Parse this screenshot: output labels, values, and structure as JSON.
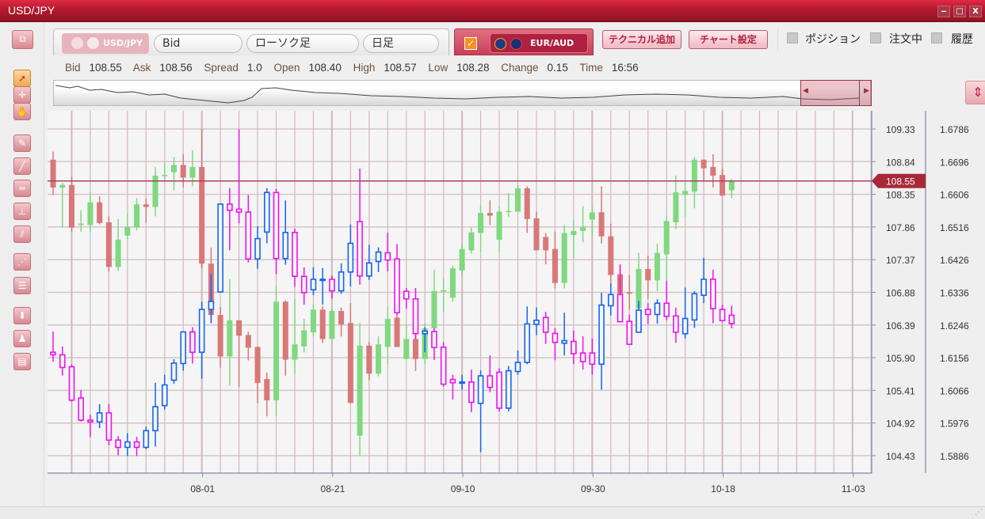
{
  "window": {
    "title": "USD/JPY",
    "controls": [
      "‒",
      "□",
      "X"
    ]
  },
  "toolbar": {
    "primary_symbol": "USD/JPY",
    "price_type": "Bid",
    "chart_type": "ローソク足",
    "timeframe": "日足",
    "compare_checked": true,
    "compare_check_glyph": "✓",
    "secondary_symbol": "EUR/AUD",
    "add_technical": "テクニカル追加",
    "chart_settings": "チャート設定",
    "toggles": [
      {
        "label": "ポジション",
        "checked": false
      },
      {
        "label": "注文中",
        "checked": false
      },
      {
        "label": "履歴",
        "checked": false
      }
    ]
  },
  "info_bar": [
    {
      "key": "Bid",
      "value": "108.55"
    },
    {
      "key": "Ask",
      "value": "108.56"
    },
    {
      "key": "Spread",
      "value": "1.0"
    },
    {
      "key": "Open",
      "value": "108.40"
    },
    {
      "key": "High",
      "value": "108.57"
    },
    {
      "key": "Low",
      "value": "108.28"
    },
    {
      "key": "Change",
      "value": "0.15"
    },
    {
      "key": "Time",
      "value": "16:56"
    }
  ],
  "left_tools": [
    "window-layout-icon",
    "cursor-icon",
    "crosshair-cursor-icon",
    "hand-icon",
    "pencil-icon",
    "trendline-icon",
    "horizontal-line-icon",
    "vertical-line-icon",
    "channel-icon",
    "fan-icon",
    "fibonacci-icon",
    "download-icon",
    "alert-icon",
    "list-icon"
  ],
  "colors": {
    "up_primary": "#80d880",
    "down_primary": "#d87878",
    "up_secondary": "#1464f0",
    "down_secondary": "#f010f0",
    "price_line": "#b04060",
    "accent": "#c02040"
  },
  "chart_data": {
    "type": "candlestick",
    "current_price_label": "108.55",
    "current_price": 108.55,
    "x_tick_labels": [
      "08-01",
      "08-21",
      "09-10",
      "09-30",
      "10-18",
      "11-03"
    ],
    "x_tick_candle_index": [
      16,
      30,
      44,
      58,
      72,
      86
    ],
    "left_axis": {
      "ylim": [
        104.43,
        109.33
      ],
      "ticks": [
        "109.33",
        "108.84",
        "108.35",
        "107.86",
        "107.37",
        "106.88",
        "106.39",
        "105.90",
        "105.41",
        "104.92",
        "104.43"
      ]
    },
    "right_axis": {
      "ylim": [
        1.5886,
        1.6786
      ],
      "ticks": [
        "1.6786",
        "1.6696",
        "1.6606",
        "1.6516",
        "1.6426",
        "1.6336",
        "1.6246",
        "1.6156",
        "1.6066",
        "1.5976",
        "1.5886"
      ]
    },
    "grid": true,
    "series": [
      {
        "name": "USD/JPY",
        "axis": "left",
        "ohlc": [
          [
            108.87,
            108.99,
            108.34,
            108.45
          ],
          [
            108.45,
            108.52,
            107.85,
            108.49
          ],
          [
            108.49,
            108.61,
            107.79,
            107.85
          ],
          [
            107.89,
            108.11,
            107.79,
            107.91
          ],
          [
            107.89,
            108.38,
            107.79,
            108.23
          ],
          [
            108.23,
            108.32,
            107.9,
            107.92
          ],
          [
            107.93,
            108.02,
            107.19,
            107.26
          ],
          [
            107.26,
            107.98,
            107.2,
            107.67
          ],
          [
            107.73,
            108.07,
            107.68,
            107.86
          ],
          [
            107.85,
            108.29,
            107.81,
            108.2
          ],
          [
            108.2,
            108.29,
            107.92,
            108.16
          ],
          [
            108.16,
            108.76,
            108.02,
            108.63
          ],
          [
            108.63,
            108.82,
            108.56,
            108.64
          ],
          [
            108.68,
            108.91,
            108.41,
            108.79
          ],
          [
            108.79,
            108.95,
            108.45,
            108.6
          ],
          [
            108.6,
            109.01,
            108.47,
            108.76
          ],
          [
            108.76,
            109.33,
            107.24,
            107.31
          ],
          [
            107.31,
            107.55,
            106.42,
            106.54
          ],
          [
            106.54,
            106.66,
            105.75,
            105.92
          ],
          [
            105.92,
            107.08,
            105.48,
            106.46
          ],
          [
            106.46,
            106.46,
            105.46,
            106.23
          ],
          [
            106.24,
            106.29,
            105.86,
            106.05
          ],
          [
            106.06,
            106.07,
            105.22,
            105.52
          ],
          [
            105.58,
            105.68,
            105.02,
            105.26
          ],
          [
            105.26,
            106.98,
            105.02,
            106.74
          ],
          [
            106.74,
            106.76,
            105.63,
            105.87
          ],
          [
            105.87,
            106.78,
            105.66,
            106.1
          ],
          [
            106.07,
            106.48,
            105.98,
            106.31
          ],
          [
            106.28,
            106.7,
            106.22,
            106.62
          ],
          [
            106.62,
            106.67,
            106.12,
            106.18
          ],
          [
            106.18,
            106.66,
            106.18,
            106.6
          ],
          [
            106.6,
            106.65,
            106.22,
            106.4
          ],
          [
            106.42,
            106.72,
            105.22,
            105.22
          ],
          [
            104.73,
            106.42,
            104.43,
            106.08
          ],
          [
            106.08,
            106.14,
            105.56,
            105.66
          ],
          [
            105.66,
            106.22,
            105.62,
            106.1
          ],
          [
            106.06,
            106.66,
            105.8,
            106.48
          ],
          [
            106.5,
            106.55,
            106.06,
            106.06
          ],
          [
            105.88,
            106.4,
            105.88,
            106.18
          ],
          [
            106.18,
            106.37,
            105.7,
            105.88
          ],
          [
            105.88,
            106.42,
            105.8,
            106.34
          ],
          [
            106.34,
            107.22,
            106.24,
            106.9
          ],
          [
            106.9,
            107.1,
            106.58,
            106.91
          ],
          [
            106.8,
            107.28,
            106.74,
            107.24
          ],
          [
            107.21,
            107.59,
            107.14,
            107.53
          ],
          [
            107.51,
            107.85,
            107.46,
            107.78
          ],
          [
            107.77,
            108.19,
            107.49,
            108.07
          ],
          [
            108.07,
            108.26,
            107.89,
            108.03
          ],
          [
            107.67,
            108.17,
            107.49,
            108.09
          ],
          [
            108.09,
            108.37,
            108.01,
            108.1
          ],
          [
            108.09,
            108.49,
            108.09,
            108.44
          ],
          [
            108.44,
            108.47,
            107.77,
            107.98
          ],
          [
            107.99,
            108.09,
            107.51,
            107.51
          ],
          [
            107.71,
            107.77,
            107.3,
            107.51
          ],
          [
            107.53,
            107.79,
            106.94,
            107.02
          ],
          [
            107.02,
            107.89,
            106.94,
            107.77
          ],
          [
            107.74,
            107.97,
            107.39,
            107.8
          ],
          [
            107.8,
            108.17,
            107.63,
            107.86
          ],
          [
            107.97,
            108.17,
            107.73,
            108.08
          ],
          [
            108.08,
            108.47,
            107.61,
            107.72
          ],
          [
            107.72,
            107.91,
            107.02,
            107.14
          ],
          [
            107.15,
            107.3,
            106.62,
            106.86
          ],
          [
            106.88,
            107.14,
            106.62,
            106.86
          ],
          [
            106.64,
            107.47,
            106.64,
            107.23
          ],
          [
            107.23,
            107.43,
            106.78,
            107.06
          ],
          [
            107.06,
            107.61,
            106.9,
            107.47
          ],
          [
            107.45,
            108.03,
            107.06,
            107.95
          ],
          [
            107.93,
            108.63,
            107.83,
            108.38
          ],
          [
            108.34,
            108.53,
            108.01,
            108.4
          ],
          [
            108.39,
            108.91,
            108.14,
            108.87
          ],
          [
            108.87,
            108.87,
            108.56,
            108.74
          ],
          [
            108.76,
            108.95,
            108.45,
            108.63
          ],
          [
            108.64,
            108.73,
            108.33,
            108.33
          ],
          [
            108.41,
            108.58,
            108.29,
            108.55
          ]
        ]
      },
      {
        "name": "EUR/AUD",
        "axis": "right",
        "ohlc": [
          [
            1.6171,
            1.6228,
            1.6145,
            1.6164
          ],
          [
            1.6164,
            1.6187,
            1.6107,
            1.6129
          ],
          [
            1.6131,
            1.6138,
            1.6035,
            1.6039
          ],
          [
            1.6045,
            1.6067,
            1.598,
            1.5984
          ],
          [
            1.5984,
            1.5999,
            1.5937,
            1.5979
          ],
          [
            1.5979,
            1.6028,
            1.5962,
            1.6004
          ],
          [
            1.6004,
            1.6028,
            1.5915,
            1.5929
          ],
          [
            1.5929,
            1.594,
            1.5887,
            1.5909
          ],
          [
            1.5909,
            1.5948,
            1.5885,
            1.5924
          ],
          [
            1.5924,
            1.5938,
            1.5885,
            1.5909
          ],
          [
            1.5909,
            1.5966,
            1.5904,
            1.5955
          ],
          [
            1.5955,
            1.6087,
            1.5911,
            1.6021
          ],
          [
            1.6024,
            1.6109,
            1.6013,
            1.6081
          ],
          [
            1.6094,
            1.6152,
            1.6084,
            1.6141
          ],
          [
            1.614,
            1.6227,
            1.612,
            1.6227
          ],
          [
            1.6227,
            1.624,
            1.614,
            1.6171
          ],
          [
            1.6171,
            1.631,
            1.6098,
            1.6289
          ],
          [
            1.6289,
            1.6386,
            1.6251,
            1.6311
          ],
          [
            1.6337,
            1.6579,
            1.6337,
            1.6579
          ],
          [
            1.6579,
            1.6623,
            1.6452,
            1.6562
          ],
          [
            1.6565,
            1.6785,
            1.6526,
            1.6557
          ],
          [
            1.6557,
            1.6604,
            1.6418,
            1.6428
          ],
          [
            1.6428,
            1.6518,
            1.6401,
            1.6484
          ],
          [
            1.6502,
            1.6623,
            1.6471,
            1.6611
          ],
          [
            1.6611,
            1.6621,
            1.6386,
            1.6429
          ],
          [
            1.6429,
            1.6589,
            1.6412,
            1.6501
          ],
          [
            1.6501,
            1.6511,
            1.6351,
            1.638
          ],
          [
            1.638,
            1.6405,
            1.6302,
            1.6335
          ],
          [
            1.6343,
            1.6405,
            1.6328,
            1.6372
          ],
          [
            1.6371,
            1.6403,
            1.6302,
            1.6372
          ],
          [
            1.6372,
            1.6382,
            1.6319,
            1.634
          ],
          [
            1.634,
            1.6416,
            1.6332,
            1.6392
          ],
          [
            1.6392,
            1.6523,
            1.6352,
            1.6471
          ],
          [
            1.6531,
            1.6677,
            1.6357,
            1.6381
          ],
          [
            1.6381,
            1.6467,
            1.637,
            1.6417
          ],
          [
            1.6421,
            1.646,
            1.6392,
            1.6447
          ],
          [
            1.6445,
            1.65,
            1.6394,
            1.6425
          ],
          [
            1.6428,
            1.6469,
            1.6273,
            1.628
          ],
          [
            1.6339,
            1.6348,
            1.6291,
            1.6318
          ],
          [
            1.6318,
            1.6348,
            1.6207,
            1.6222
          ],
          [
            1.6222,
            1.624,
            1.6171,
            1.6229
          ],
          [
            1.6228,
            1.6237,
            1.615,
            1.6184
          ],
          [
            1.6185,
            1.6199,
            1.6076,
            1.6083
          ],
          [
            1.6096,
            1.6109,
            1.6041,
            1.6087
          ],
          [
            1.6087,
            1.6109,
            1.6068,
            1.6089
          ],
          [
            1.6089,
            1.6123,
            1.6006,
            1.6033
          ],
          [
            1.603,
            1.6121,
            1.5896,
            1.6106
          ],
          [
            1.6106,
            1.6162,
            1.6061,
            1.6074
          ],
          [
            1.6116,
            1.6127,
            1.6008,
            1.6017
          ],
          [
            1.6017,
            1.6133,
            1.6008,
            1.612
          ],
          [
            1.6118,
            1.6176,
            1.6109,
            1.6143
          ],
          [
            1.6143,
            1.6297,
            1.6138,
            1.6249
          ],
          [
            1.6248,
            1.6294,
            1.6218,
            1.6259
          ],
          [
            1.6267,
            1.6282,
            1.6194,
            1.6226
          ],
          [
            1.6223,
            1.6237,
            1.6149,
            1.6198
          ],
          [
            1.6196,
            1.628,
            1.6162,
            1.6203
          ],
          [
            1.6201,
            1.6231,
            1.6138,
            1.6167
          ],
          [
            1.6169,
            1.6215,
            1.6123,
            1.6145
          ],
          [
            1.6169,
            1.6209,
            1.6109,
            1.6138
          ],
          [
            1.6138,
            1.6335,
            1.6068,
            1.6301
          ],
          [
            1.6299,
            1.6361,
            1.6272,
            1.633
          ],
          [
            1.633,
            1.6412,
            1.6255,
            1.6255
          ],
          [
            1.6256,
            1.6275,
            1.6193,
            1.6193
          ],
          [
            1.6226,
            1.6312,
            1.6226,
            1.6287
          ],
          [
            1.6289,
            1.6306,
            1.6248,
            1.6275
          ],
          [
            1.6275,
            1.6317,
            1.625,
            1.6306
          ],
          [
            1.6306,
            1.6368,
            1.6259,
            1.627
          ],
          [
            1.6271,
            1.6294,
            1.6197,
            1.6226
          ],
          [
            1.6222,
            1.6349,
            1.6209,
            1.6264
          ],
          [
            1.626,
            1.6339,
            1.6238,
            1.6332
          ],
          [
            1.6328,
            1.6431,
            1.6306,
            1.6372
          ],
          [
            1.6372,
            1.6398,
            1.6251,
            1.6291
          ],
          [
            1.6289,
            1.6302,
            1.6255,
            1.6258
          ],
          [
            1.6273,
            1.6299,
            1.6237,
            1.625
          ]
        ]
      }
    ]
  }
}
